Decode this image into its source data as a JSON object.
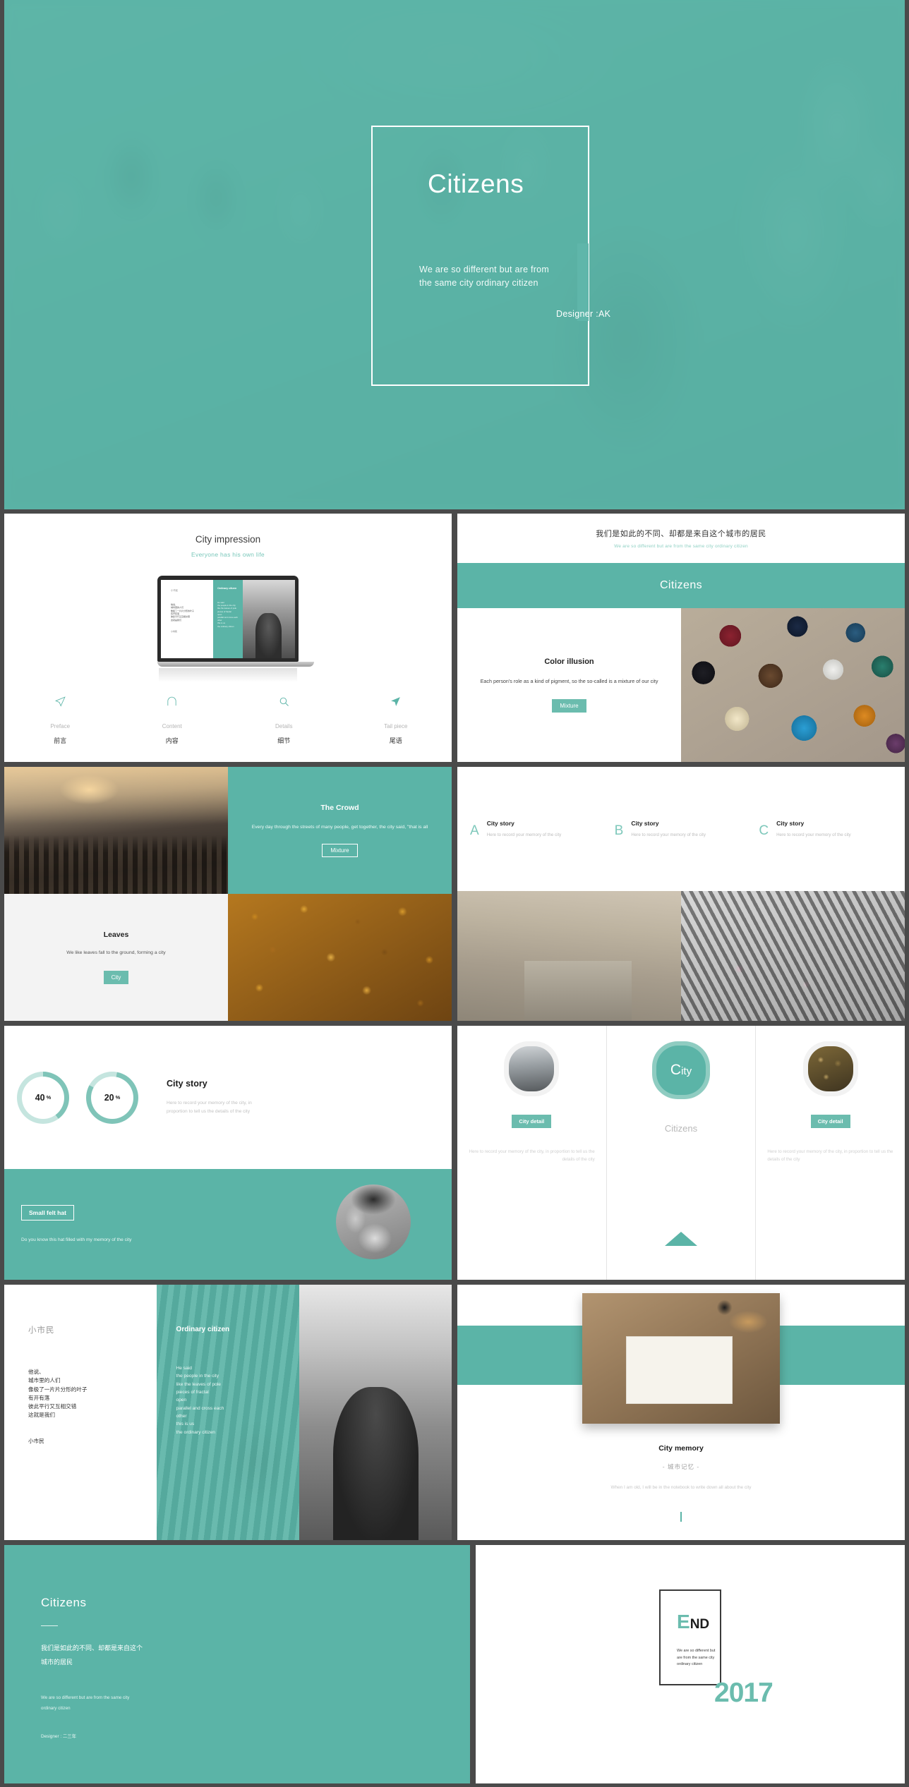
{
  "theme": {
    "accent": "#5bb4a7",
    "accent_light": "#8fccc1",
    "accent_track": "#c5e5df",
    "ink": "#1c1c1c",
    "muted": "#c2c2c2"
  },
  "hero": {
    "title": "Citizens",
    "subtitle": "We are so different but are from the same city ordinary citizen",
    "designer": "Designer :AK"
  },
  "slides": [
    {
      "id": "city-impression",
      "title": "City impression",
      "subtitle": "Everyone has his own life",
      "laptop": {
        "left_heading": "小市民",
        "left_body": "他说、\n城市里的人们\n像极了一片片分形的叶子\n有开有落\n彼此平行又互相交错\n这就是我们",
        "left_footer": "小市民",
        "mid_heading": "Ordinary citizen",
        "mid_body": "He said\nthe people in the city\nlike the leaves of pole\npieces of fractal\nopen\nparallel and cross each\nother\nthis is us\nthe ordinary citizen"
      },
      "nav": [
        {
          "icon": "send-icon",
          "en": "Preface",
          "cn": "前言"
        },
        {
          "icon": "arch-icon",
          "en": "Content",
          "cn": "内容"
        },
        {
          "icon": "search-icon",
          "en": "Details",
          "cn": "细节"
        },
        {
          "icon": "paper-plane-icon",
          "en": "Tail piece",
          "cn": "尾语"
        }
      ]
    },
    {
      "id": "color-illusion",
      "header_cn": "我们是如此的不同、却都是来自这个城市的居民",
      "header_en": "We are so different  but are from the same city ordinary citizen",
      "band_title": "Citizens",
      "card_title": "Color illusion",
      "card_body": "Each person's role as a kind of pigment, so the so-called is a mixture of our city",
      "card_button": "Mixture"
    },
    {
      "id": "crowd-leaves",
      "crowd_title": "The Crowd",
      "crowd_body": "Every day through the streets of many people, get together, the city said, \"that is all",
      "crowd_button": "Mixture",
      "leaves_title": "Leaves",
      "leaves_body": "We like leaves fall to the ground, forming a city",
      "leaves_button": "City"
    },
    {
      "id": "city-story-abc",
      "items": [
        {
          "letter": "A",
          "title": "City story",
          "body": "Here to record your memory of the city"
        },
        {
          "letter": "B",
          "title": "City story",
          "body": "Here to record your memory of the city"
        },
        {
          "letter": "C",
          "title": "City story",
          "body": "Here to record your memory of the city"
        }
      ]
    },
    {
      "id": "donut-city-story",
      "title": "City story",
      "body": "Here to record your memory of the city, in proportion to tell us the details of the city",
      "hat_label": "Small felt hat",
      "hat_body": "Do you know this hat filled with my memory of the city"
    },
    {
      "id": "city-detail-three",
      "left_button": "City detail",
      "left_body": "Here to record your memory of the city, in proportion to tell us the details of the city",
      "center_badge_first": "C",
      "center_badge_rest": "ity",
      "center_label": "Citizens",
      "right_button": "City detail",
      "right_body": "Here to record your memory of the city, in proportion to tell us the details of the city"
    },
    {
      "id": "ordinary-citizen",
      "cn_heading": "小市民",
      "cn_body": "他说、\n城市里的人们\n像极了一片片分形的叶子\n有开有落\n彼此平行又互相交错\n这就是我们",
      "cn_sign": "小市民",
      "en_heading": "Ordinary citizen",
      "en_body": "He said\nthe people in the city\n like the leaves of pole\npieces of fractal\nopen\nparallel and cross each\nother\nthis is us\nthe ordinary citizen"
    },
    {
      "id": "city-memory",
      "title": "City memory",
      "cn": "-  城市记忆 -",
      "body": "When I am old, I will be in the notebook to write down all about the city"
    },
    {
      "id": "closing-teal",
      "title": "Citizens",
      "cn": "我们是如此的不同、却都是来自这个\n城市的居民",
      "en": "We are so different  but are from the same city\nordinary citizen",
      "designer": "Designer : 二三年"
    },
    {
      "id": "end-card",
      "end_first": "E",
      "end_rest": "ND",
      "body": "We are so different but are from the same city ordinary citizen",
      "year": "2017"
    }
  ],
  "chart_data": {
    "type": "pie",
    "title": "City story",
    "charts": [
      {
        "label": "40 %",
        "value": 40,
        "max": 100,
        "arc_color": "#7fc4b8",
        "track_color": "#c5e5df"
      },
      {
        "label": "20 %",
        "value": 20,
        "max": 100,
        "arc_color": "#7fc4b8",
        "track_color": "#c5e5df"
      }
    ]
  }
}
